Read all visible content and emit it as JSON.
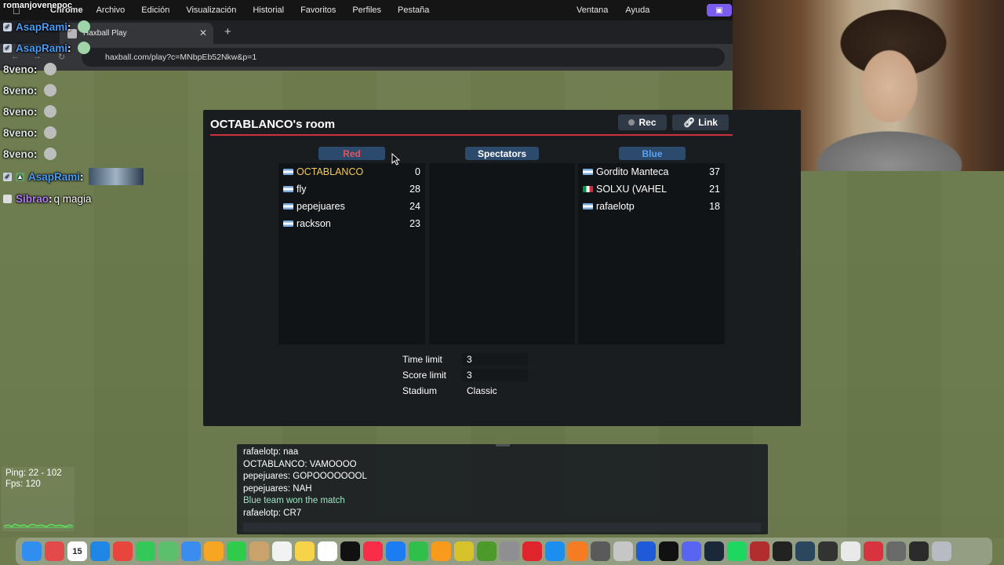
{
  "menubar": {
    "app_name": "Chrome",
    "left_items": [
      "Archivo",
      "Edición",
      "Visualización",
      "Historial",
      "Favoritos",
      "Perfiles",
      "Pestaña"
    ],
    "right_items": [
      "Ventana",
      "Ayuda"
    ]
  },
  "browser": {
    "tab_title": "Haxball Play",
    "url": "haxball.com/play?c=MNbpEb52Nkw&p=1"
  },
  "stream_chat": {
    "streamer": "romanjovenepoc",
    "lines": [
      {
        "user": "AsapRami",
        "style": "blue",
        "kind": "emote"
      },
      {
        "user": "AsapRami",
        "style": "blue",
        "kind": "emote"
      },
      {
        "user": "8veno",
        "style": "green",
        "kind": "skull"
      },
      {
        "user": "8veno",
        "style": "green",
        "kind": "skull"
      },
      {
        "user": "8veno",
        "style": "green",
        "kind": "skull"
      },
      {
        "user": "8veno",
        "style": "green",
        "kind": "skull"
      },
      {
        "user": "8veno",
        "style": "green",
        "kind": "skull"
      },
      {
        "user": "AsapRami",
        "style": "blue",
        "kind": "image"
      },
      {
        "user": "Sibrao",
        "style": "purple",
        "kind": "text",
        "message": "q magia"
      }
    ]
  },
  "room": {
    "title": "OCTABLANCO's room",
    "rec_label": "Rec",
    "link_label": "Link",
    "teams": {
      "red": {
        "label": "Red",
        "players": [
          {
            "name": "OCTABLANCO",
            "ping": "0",
            "flag": "ar",
            "self": true
          },
          {
            "name": "fly",
            "ping": "28",
            "flag": "ar",
            "self": false
          },
          {
            "name": "pepejuares",
            "ping": "24",
            "flag": "ar",
            "self": false
          },
          {
            "name": "rackson",
            "ping": "23",
            "flag": "ar",
            "self": false
          }
        ]
      },
      "spectators": {
        "label": "Spectators",
        "players": []
      },
      "blue": {
        "label": "Blue",
        "players": [
          {
            "name": "Gordito Manteca",
            "ping": "37",
            "flag": "ar",
            "self": false
          },
          {
            "name": "SOLXU (VAHEL",
            "ping": "21",
            "flag": "it",
            "self": false
          },
          {
            "name": "rafaelotp",
            "ping": "18",
            "flag": "ar",
            "self": false
          }
        ]
      }
    },
    "settings": {
      "time_limit_label": "Time limit",
      "time_limit": "3",
      "score_limit_label": "Score limit",
      "score_limit": "3",
      "stadium_label": "Stadium",
      "stadium": "Classic"
    }
  },
  "game_chat": [
    {
      "text": "rafaelotp: naa",
      "notice": false
    },
    {
      "text": "OCTABLANCO: VAMOOOO",
      "notice": false
    },
    {
      "text": "pepejuares: GOPOOOOOOOL",
      "notice": false
    },
    {
      "text": "pepejuares: NAH",
      "notice": false
    },
    {
      "text": "Blue team won the match",
      "notice": true
    },
    {
      "text": "rafaelotp: CR7",
      "notice": false
    }
  ],
  "stats": {
    "ping": "Ping: 22 - 102",
    "fps": "Fps: 120"
  },
  "dock": {
    "calendar_day": "15",
    "icons": [
      {
        "name": "finder-icon",
        "color": "#2f8ef0"
      },
      {
        "name": "launchpad-icon",
        "color": "#e24a4a"
      },
      {
        "name": "calendar-icon",
        "color": "#ffffff"
      },
      {
        "name": "safari-icon",
        "color": "#1f86e8"
      },
      {
        "name": "chrome-icon",
        "color": "#e8453c"
      },
      {
        "name": "messages-icon",
        "color": "#34c759"
      },
      {
        "name": "maps-icon",
        "color": "#5bbf6b"
      },
      {
        "name": "mail-icon",
        "color": "#3b8cf0"
      },
      {
        "name": "photos-icon",
        "color": "#f6a623"
      },
      {
        "name": "facetime-icon",
        "color": "#2ecc4a"
      },
      {
        "name": "contacts-icon",
        "color": "#c9a36b"
      },
      {
        "name": "reminders-icon",
        "color": "#f2f2f2"
      },
      {
        "name": "notes-icon",
        "color": "#f7d34a"
      },
      {
        "name": "freeform-icon",
        "color": "#ffffff"
      },
      {
        "name": "tv-icon",
        "color": "#111111"
      },
      {
        "name": "music-icon",
        "color": "#fa2d48"
      },
      {
        "name": "keynote-icon",
        "color": "#1c7df2"
      },
      {
        "name": "numbers-icon",
        "color": "#2fbf4a"
      },
      {
        "name": "pages-icon",
        "color": "#f89b1c"
      },
      {
        "name": "game-icon",
        "color": "#d8c22a"
      },
      {
        "name": "minecraft-icon",
        "color": "#4c9a2a"
      },
      {
        "name": "settings-icon",
        "color": "#8e8e93"
      },
      {
        "name": "roblox-icon",
        "color": "#e0242b"
      },
      {
        "name": "appstore-icon",
        "color": "#1c8ef0"
      },
      {
        "name": "garageband-icon",
        "color": "#f57c23"
      },
      {
        "name": "utility-icon",
        "color": "#5a5a5a"
      },
      {
        "name": "preview-icon",
        "color": "#c6c6c6"
      },
      {
        "name": "capcut-icon",
        "color": "#1e5bd8"
      },
      {
        "name": "kick-icon",
        "color": "#111111"
      },
      {
        "name": "discord-icon",
        "color": "#5865f2"
      },
      {
        "name": "steam-icon",
        "color": "#1b2838"
      },
      {
        "name": "spotify-icon",
        "color": "#1ed760"
      },
      {
        "name": "dictionary-icon",
        "color": "#b22d2d"
      },
      {
        "name": "ea-icon",
        "color": "#222222"
      },
      {
        "name": "steam-alt-icon",
        "color": "#2a475e"
      },
      {
        "name": "xbox-icon",
        "color": "#333333"
      },
      {
        "name": "docs-icon",
        "color": "#e9e9e9"
      },
      {
        "name": "pdf-icon",
        "color": "#d9333f"
      },
      {
        "name": "folder-icon",
        "color": "#6a6a6a"
      },
      {
        "name": "terminal-icon",
        "color": "#2b2b2b"
      },
      {
        "name": "trash-icon",
        "color": "#b8bcc2"
      }
    ]
  }
}
